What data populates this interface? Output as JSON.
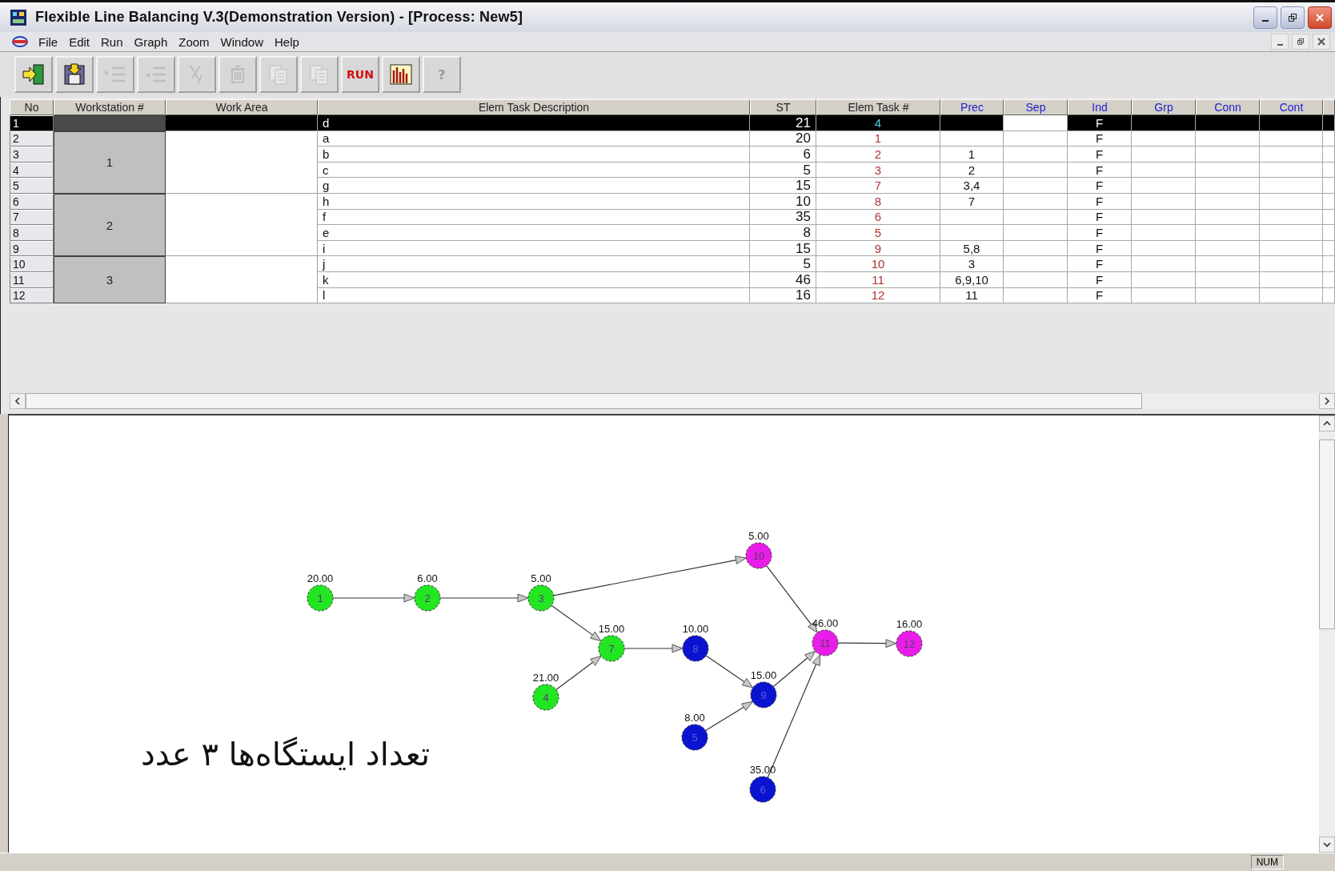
{
  "window": {
    "title": "Flexible Line Balancing V.3(Demonstration Version) - [Process: New5]"
  },
  "menu": [
    "File",
    "Edit",
    "Run",
    "Graph",
    "Zoom",
    "Window",
    "Help"
  ],
  "toolbar": [
    {
      "kind": "exit",
      "disabled": false
    },
    {
      "kind": "save",
      "disabled": false
    },
    {
      "kind": "indent",
      "disabled": true
    },
    {
      "kind": "outdent",
      "disabled": true
    },
    {
      "kind": "cut",
      "disabled": true
    },
    {
      "kind": "delete",
      "disabled": true
    },
    {
      "kind": "copy",
      "disabled": true
    },
    {
      "kind": "paste",
      "disabled": true
    },
    {
      "kind": "text",
      "label": "RUN",
      "disabled": false
    },
    {
      "kind": "chart",
      "disabled": false
    },
    {
      "kind": "text",
      "label": "?",
      "disabled": true
    }
  ],
  "table": {
    "columns": [
      {
        "label": "No",
        "kind": "plain"
      },
      {
        "label": "Workstation #",
        "kind": "plain"
      },
      {
        "label": "Work Area",
        "kind": "plain"
      },
      {
        "label": "Elem Task Description",
        "kind": "plain"
      },
      {
        "label": "ST",
        "kind": "plain"
      },
      {
        "label": "Elem Task #",
        "kind": "plain"
      },
      {
        "label": "Prec",
        "kind": "flag"
      },
      {
        "label": "Sep",
        "kind": "flag"
      },
      {
        "label": "Ind",
        "kind": "flag"
      },
      {
        "label": "Grp",
        "kind": "flag"
      },
      {
        "label": "Conn",
        "kind": "flag"
      },
      {
        "label": "Cont",
        "kind": "flag"
      }
    ],
    "groups": [
      {
        "rows": [
          {
            "no": "1",
            "desc": "d",
            "st": "21",
            "task": "4",
            "ind": "F",
            "selected": true
          }
        ]
      },
      {
        "workstation": "1",
        "rows": [
          {
            "no": "2",
            "desc": "a",
            "st": "20",
            "task": "1",
            "ind": "F",
            "selected": false
          },
          {
            "no": "3",
            "desc": "b",
            "st": "6",
            "task": "2",
            "prec": "1",
            "ind": "F",
            "selected": false
          },
          {
            "no": "4",
            "desc": "c",
            "st": "5",
            "task": "3",
            "prec": "2",
            "ind": "F",
            "selected": false
          },
          {
            "no": "5",
            "desc": "g",
            "st": "15",
            "task": "7",
            "prec": "3,4",
            "ind": "F",
            "selected": false
          }
        ]
      },
      {
        "workstation": "2",
        "rows": [
          {
            "no": "6",
            "desc": "h",
            "st": "10",
            "task": "8",
            "prec": "7",
            "ind": "F",
            "selected": false
          },
          {
            "no": "7",
            "desc": "f",
            "st": "35",
            "task": "6",
            "ind": "F",
            "selected": false
          },
          {
            "no": "8",
            "desc": "e",
            "st": "8",
            "task": "5",
            "ind": "F",
            "selected": false
          },
          {
            "no": "9",
            "desc": "i",
            "st": "15",
            "task": "9",
            "prec": "5,8",
            "ind": "F",
            "selected": false
          }
        ]
      },
      {
        "workstation": "3",
        "rows": [
          {
            "no": "10",
            "desc": "j",
            "st": "5",
            "task": "10",
            "prec": "3",
            "ind": "F",
            "selected": false
          },
          {
            "no": "11",
            "desc": "k",
            "st": "46",
            "task": "11",
            "prec": "6,9,10",
            "ind": "F",
            "selected": false
          },
          {
            "no": "12",
            "desc": "l",
            "st": "16",
            "task": "12",
            "prec": "11",
            "ind": "F",
            "selected": false
          }
        ]
      }
    ]
  },
  "graph": {
    "nodes": [
      {
        "label": "10",
        "value": "5.00",
        "color": "#e81ee8"
      },
      {
        "label": "1",
        "value": "20.00",
        "color": "#22e622"
      },
      {
        "label": "2",
        "value": "6.00",
        "color": "#22e622"
      },
      {
        "label": "3",
        "value": "5.00",
        "color": "#22e622"
      },
      {
        "label": "7",
        "value": "15.00",
        "color": "#22e622"
      },
      {
        "label": "8",
        "value": "10.00",
        "color": "#0a14d0"
      },
      {
        "label": "11",
        "value": "46.00",
        "color": "#e81ee8"
      },
      {
        "label": "12",
        "value": "16.00",
        "color": "#e81ee8"
      },
      {
        "label": "4",
        "value": "21.00",
        "color": "#22e622"
      },
      {
        "label": "9",
        "value": "15.00",
        "color": "#0a14d0"
      },
      {
        "label": "5",
        "value": "8.00",
        "color": "#0a14d0"
      },
      {
        "label": "6",
        "value": "35.00",
        "color": "#0a14d0"
      }
    ],
    "annotation": "تعداد ایستگاه‌ها ۳ عدد"
  },
  "status_bar": {
    "indicator": "NUM"
  }
}
